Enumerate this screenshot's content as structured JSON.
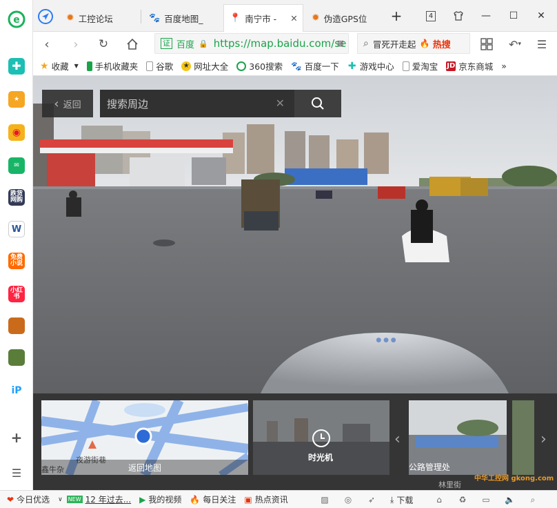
{
  "tabs": [
    {
      "title": "工控论坛",
      "icon": "gear-favicon"
    },
    {
      "title": "百度地图_",
      "icon": "baidu-paw-favicon"
    },
    {
      "title": "南宁市 - ",
      "icon": "map-pin-favicon",
      "active": true
    },
    {
      "title": "伪造GPS位",
      "icon": "gear-favicon"
    }
  ],
  "tab_count": "4",
  "address": {
    "cert": "证",
    "site": "百度",
    "url": "https://map.baidu.com/se"
  },
  "search_bar": {
    "text": "冒死开走起",
    "hot": "热搜"
  },
  "bookmarks": [
    {
      "label": "收藏",
      "icon": "star-icon"
    },
    {
      "label": "手机收藏夹",
      "icon": "phone-icon"
    },
    {
      "label": "谷歌",
      "icon": "page-icon"
    },
    {
      "label": "网址大全",
      "icon": "site-nav-icon"
    },
    {
      "label": "360搜索",
      "icon": "search-360-icon"
    },
    {
      "label": "百度一下",
      "icon": "baidu-paw-icon"
    },
    {
      "label": "游戏中心",
      "icon": "game-center-icon"
    },
    {
      "label": "爱淘宝",
      "icon": "page-icon"
    },
    {
      "label": "京东商城",
      "icon": "jd-icon"
    }
  ],
  "bookmarks_more": "»",
  "sidebar": {
    "apps": [
      {
        "name": "plus-app-icon",
        "label": "",
        "color": "#1bbfb3"
      },
      {
        "name": "favorites-app-icon",
        "label": "★",
        "color": "#f5a623"
      },
      {
        "name": "weibo-app-icon",
        "label": "",
        "color": "#e6162d"
      },
      {
        "name": "mail-app-icon",
        "label": "✉",
        "color": "#18b566"
      },
      {
        "name": "news-app-icon",
        "label": "跌货网购",
        "color": "#333a56"
      },
      {
        "name": "word-app-icon",
        "label": "W",
        "color": "#2b579a"
      },
      {
        "name": "novel-app-icon",
        "label": "免费小说",
        "color": "#ff6a00"
      },
      {
        "name": "shop-app-icon",
        "label": "小红书",
        "color": "#ff2442"
      },
      {
        "name": "game1-app-icon",
        "label": "",
        "color": "#c96b1b"
      },
      {
        "name": "game2-app-icon",
        "label": "",
        "color": "#5a7d3a"
      },
      {
        "name": "ip-app-icon",
        "label": "iP",
        "color": "#ffffff"
      }
    ]
  },
  "streetview": {
    "back_label": "返回",
    "search_placeholder": "搜索周边",
    "thumbs": [
      {
        "label": "返回地图",
        "map_labels": [
          "夜游街巷",
          "鑫牛杂"
        ]
      },
      {
        "label": "时光机"
      },
      {
        "label": "公路管理处"
      }
    ],
    "watermark": "林里街",
    "site_watermark": "中华工控网 gkong.com"
  },
  "statusbar": [
    {
      "label": "今日优选",
      "icon": "heart-icon"
    },
    {
      "label": "12 年过去...",
      "icon": "new-badge",
      "badge": "NEW"
    },
    {
      "label": "我的视频",
      "icon": "video-icon"
    },
    {
      "label": "每日关注",
      "icon": "fire-icon"
    },
    {
      "label": "热点资讯",
      "icon": "news-icon"
    }
  ],
  "statusbar_download": "下载"
}
